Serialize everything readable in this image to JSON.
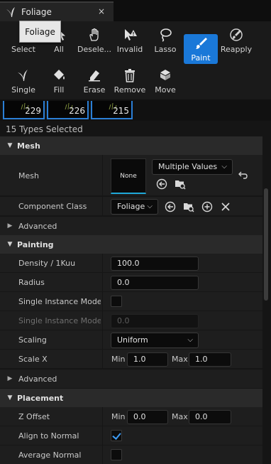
{
  "tab": {
    "title": "Foliage",
    "close": "×"
  },
  "tooltip": "Foliage",
  "toolbar": {
    "row1": [
      {
        "label": "Select",
        "icon": "select-cursor-icon"
      },
      {
        "label": "All",
        "icon": "select-all-icon"
      },
      {
        "label": "Deselect",
        "display": "Desele...",
        "icon": "deselect-hand-icon"
      },
      {
        "label": "Invalid",
        "icon": "invalid-cursor-icon"
      },
      {
        "label": "Lasso",
        "icon": "lasso-icon"
      },
      {
        "label": "Paint",
        "icon": "paint-brush-icon",
        "active": true
      },
      {
        "label": "Reapply",
        "icon": "reapply-brush-icon"
      }
    ],
    "row2": [
      {
        "label": "Single",
        "icon": "single-grass-icon"
      },
      {
        "label": "Fill",
        "icon": "fill-bucket-icon"
      },
      {
        "label": "Erase",
        "icon": "eraser-icon"
      },
      {
        "label": "Remove",
        "icon": "trash-icon"
      },
      {
        "label": "Move",
        "icon": "move-icon"
      }
    ]
  },
  "thumbnails": [
    {
      "count": "229"
    },
    {
      "count": "226"
    },
    {
      "count": "215"
    }
  ],
  "types_selected": "15 Types Selected",
  "sections": {
    "mesh": {
      "title": "Mesh",
      "mesh_label": "Mesh",
      "mesh_thumb": "None",
      "mesh_value": "Multiple Values",
      "component_class_label": "Component Class",
      "component_class_value": "Foliage",
      "advanced": "Advanced"
    },
    "painting": {
      "title": "Painting",
      "density_label": "Density / 1Kuu",
      "density_value": "100.0",
      "radius_label": "Radius",
      "radius_value": "0.0",
      "single_mode_label": "Single Instance Mode...",
      "single_mode_label2": "Single Instance Mode...",
      "single_mode_value": "0.0",
      "scaling_label": "Scaling",
      "scaling_value": "Uniform",
      "scalex_label": "Scale X",
      "min_label": "Min",
      "max_label": "Max",
      "scalex_min": "1.0",
      "scalex_max": "1.0",
      "advanced": "Advanced"
    },
    "placement": {
      "title": "Placement",
      "zoffset_label": "Z Offset",
      "min_label": "Min",
      "max_label": "Max",
      "zoffset_min": "0.0",
      "zoffset_max": "0.0",
      "align_label": "Align to Normal",
      "align_checked": true,
      "avg_label": "Average Normal",
      "avg_checked": false
    }
  },
  "colors": {
    "accent": "#1a78d8",
    "check": "#3d9cf5",
    "mesh_underline": "#1fa8d8"
  }
}
